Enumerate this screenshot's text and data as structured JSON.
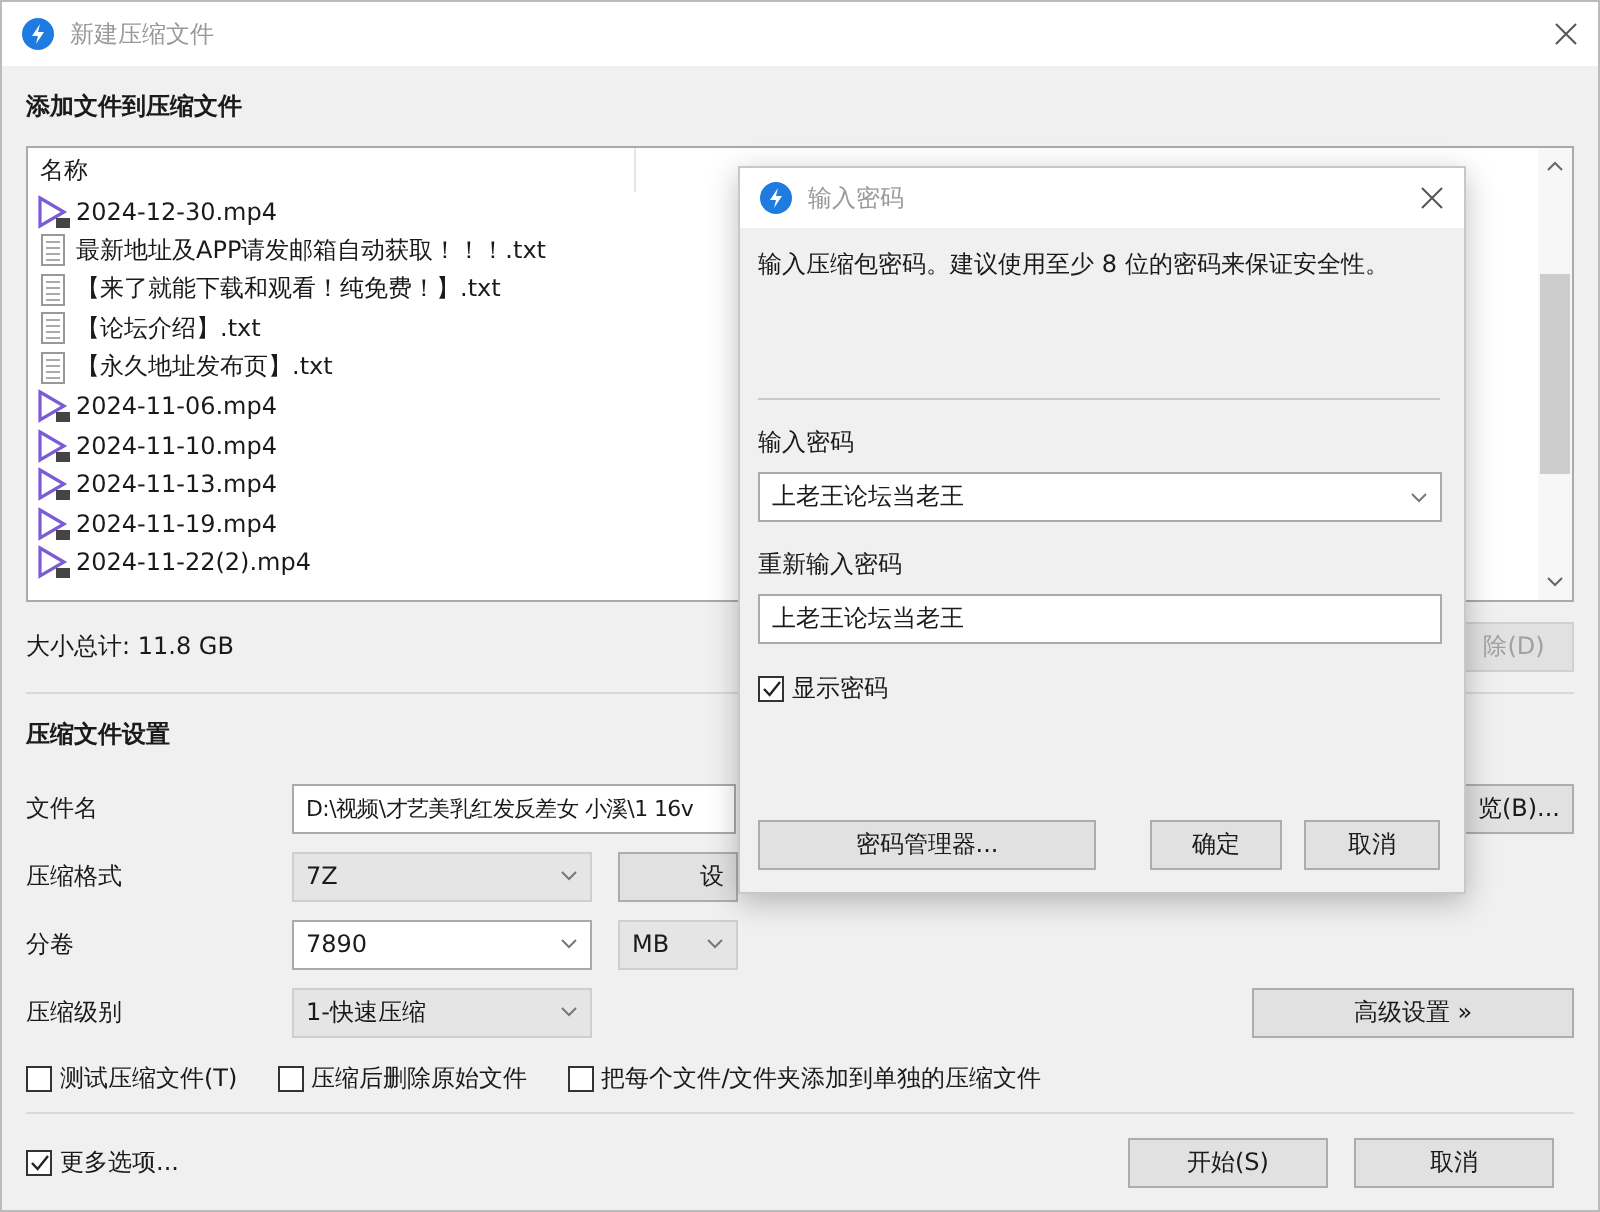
{
  "window": {
    "title": "新建压缩文件"
  },
  "files_section": {
    "title": "添加文件到压缩文件",
    "columns": [
      "名称"
    ],
    "files": [
      {
        "name": "2024-12-30.mp4",
        "kind": "video"
      },
      {
        "name": "最新地址及APP请发邮箱自动获取！！！.txt",
        "kind": "text"
      },
      {
        "name": "【来了就能下载和观看！纯免费！】.txt",
        "kind": "text"
      },
      {
        "name": "【论坛介绍】.txt",
        "kind": "text"
      },
      {
        "name": "【永久地址发布页】.txt",
        "kind": "text"
      },
      {
        "name": "2024-11-06.mp4",
        "kind": "video"
      },
      {
        "name": "2024-11-10.mp4",
        "kind": "video"
      },
      {
        "name": "2024-11-13.mp4",
        "kind": "video"
      },
      {
        "name": "2024-11-19.mp4",
        "kind": "video"
      },
      {
        "name": "2024-11-22(2).mp4",
        "kind": "video"
      }
    ],
    "total": "大小总计: 11.8 GB",
    "delete_button": "除(D)"
  },
  "settings": {
    "title": "压缩文件设置",
    "filename": {
      "label": "文件名",
      "value": "D:\\视频\\才艺美乳红发反差女 小溪\\1 16v",
      "browse_button": "览(B)..."
    },
    "format": {
      "label": "压缩格式",
      "value": "7Z",
      "settings_button": "设"
    },
    "split": {
      "label": "分卷",
      "value": "7890",
      "unit": "MB"
    },
    "level": {
      "label": "压缩级别",
      "value": "1-快速压缩",
      "advanced_button": "高级设置 »"
    },
    "options": [
      {
        "label": "测试压缩文件(T)",
        "checked": false
      },
      {
        "label": "压缩后删除原始文件",
        "checked": false
      },
      {
        "label": "把每个文件/文件夹添加到单独的压缩文件",
        "checked": false
      }
    ]
  },
  "footer": {
    "more_options": {
      "label": "更多选项...",
      "checked": true
    },
    "buttons": [
      "开始(S)",
      "取消"
    ]
  },
  "password_dialog": {
    "title": "输入密码",
    "description": "输入压缩包密码。建议使用至少 8 位的密码来保证安全性。",
    "password_label": "输入密码",
    "password": "上老王论坛当老王",
    "confirm_label": "重新输入密码",
    "confirm": "上老王论坛当老王",
    "show_password": {
      "label": "显示密码",
      "checked": true
    },
    "buttons": [
      "密码管理器...",
      "确定",
      "取消"
    ]
  }
}
